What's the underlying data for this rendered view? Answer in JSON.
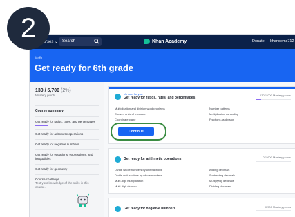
{
  "step_number": "2",
  "topbar": {
    "courses_label": "Courses",
    "search_label": "Search",
    "logo_text": "Khan Academy",
    "donate_label": "Donate",
    "user_label": "khandems712"
  },
  "hero": {
    "subject": "Math",
    "title": "Get ready for 6th grade"
  },
  "sidebar": {
    "points": "130 / 5,700",
    "points_pct": "(2%)",
    "points_sub": "Mastery points",
    "items": [
      {
        "label": "Course summary",
        "bold": true
      },
      {
        "label": "Get ready for ratios, rates, and percentages",
        "active": true
      },
      {
        "label": "Get ready for arithmetic operations"
      },
      {
        "label": "Get ready for negative numbers"
      },
      {
        "label": "Get ready for equations, expressions, and inequalities"
      },
      {
        "label": "Get ready for geometry"
      },
      {
        "label": "Course challenge",
        "sub": "Test your knowledge of the skills in this course."
      }
    ]
  },
  "units": [
    {
      "up_next": "Up next for you:",
      "title": "Get ready for ratios, rates, and percentages",
      "mastery": "130/1,000 Mastery points",
      "progress": 0.13,
      "skills_left": [
        "Multiplication and division word problems",
        "Convert units of measure",
        "Coordinate plane"
      ],
      "skills_right": [
        "Number patterns",
        "Multiplication as scaling",
        "Fractions as division"
      ],
      "button_label": "Continue"
    },
    {
      "title": "Get ready for arithmetic operations",
      "mastery": "0/1,600 Mastery points",
      "progress": 0,
      "skills_left": [
        "Divide whole numbers by unit fractions",
        "Divide unit fractions by whole numbers",
        "Multi-digit multiplication",
        "Multi-digit division"
      ],
      "skills_right": [
        "Adding decimals",
        "Subtracting decimals",
        "Multiplying decimals",
        "Dividing decimals"
      ]
    },
    {
      "title": "Get ready for negative numbers",
      "mastery": "0/900 Mastery points",
      "progress": 0
    }
  ],
  "colors": {
    "nav": "#0b2149",
    "brand_blue": "#1865f2",
    "mastery_purple": "#8c6cf2",
    "highlight_green": "#3a8c42"
  }
}
